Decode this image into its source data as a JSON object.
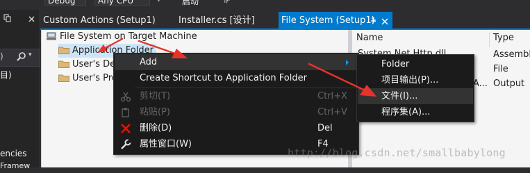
{
  "toolbar": {
    "config": "Debug",
    "platform": "Any CPU",
    "run_label": "启动"
  },
  "left_panel": {
    "rows": [
      "目)",
      "encies",
      "Framew"
    ]
  },
  "tabs": [
    {
      "label": "Custom Actions (Setup1)",
      "active": false
    },
    {
      "label": "Installer.cs [设计]",
      "active": false
    },
    {
      "label": "File System (Setup1)",
      "active": true
    }
  ],
  "tree": {
    "root": "File System on Target Machine",
    "items": [
      "Application Folder",
      "User's Desktop",
      "User's Programs Menu"
    ]
  },
  "list": {
    "headers": [
      "Name",
      "Type"
    ],
    "rows": [
      {
        "name": "System.Net.Http.dll",
        "type": "Assembly"
      },
      {
        "name": "",
        "type": "File"
      },
      {
        "name": "A...",
        "type": "Output"
      }
    ]
  },
  "context_menu": {
    "items": [
      {
        "label": "Add",
        "shortcut": "",
        "icon": "",
        "submenu": true,
        "disabled": false
      },
      {
        "label": "Create Shortcut to Application Folder",
        "shortcut": "",
        "icon": "",
        "submenu": false,
        "disabled": false
      },
      {
        "label": "剪切(T)",
        "shortcut": "Ctrl+X",
        "icon": "scissors-icon",
        "submenu": false,
        "disabled": true
      },
      {
        "label": "粘贴(P)",
        "shortcut": "Ctrl+V",
        "icon": "paste-icon",
        "submenu": false,
        "disabled": true
      },
      {
        "label": "删除(D)",
        "shortcut": "Del",
        "icon": "delete-x-icon",
        "submenu": false,
        "disabled": false
      },
      {
        "label": "属性窗口(W)",
        "shortcut": "F4",
        "icon": "wrench-icon",
        "submenu": false,
        "disabled": false
      }
    ]
  },
  "submenu": {
    "items": [
      "Folder",
      "项目输出(P)...",
      "文件(I)...",
      "程序集(A)..."
    ]
  },
  "watermark": "http://blog.csdn.net/smallbabylong",
  "colors": {
    "accent": "#007acc",
    "menu_bg": "#1b1b1c",
    "arrow": "#e8332a",
    "delete_icon": "#e51400"
  }
}
